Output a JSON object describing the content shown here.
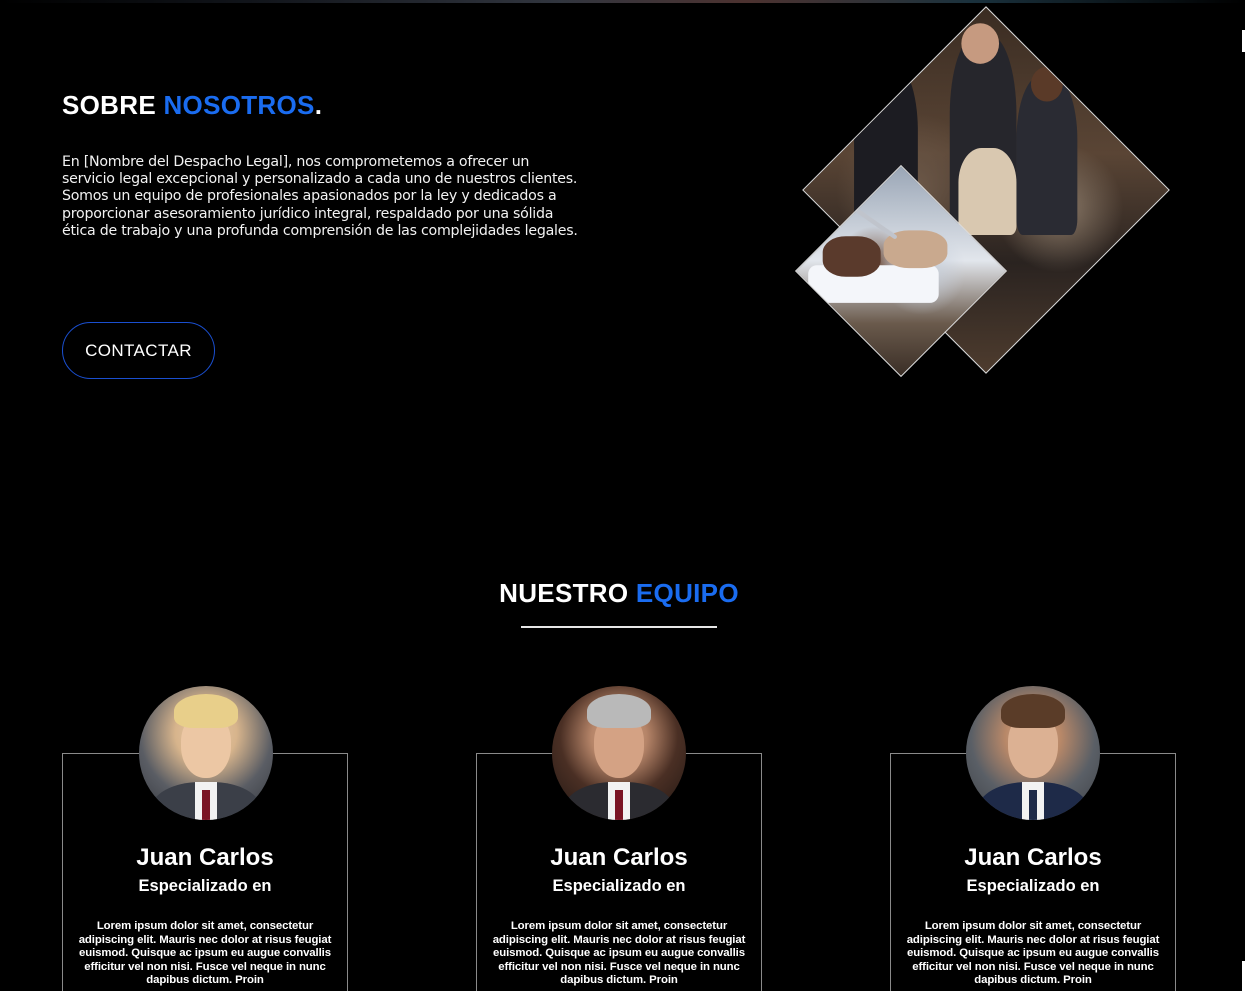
{
  "theme": {
    "accent": "#1a6cf0",
    "background": "#000000",
    "button_border": "#1a4fd0"
  },
  "about": {
    "title_main": "SOBRE ",
    "title_accent": "NOSOTROS",
    "title_dot": ".",
    "text": "En [Nombre del Despacho Legal], nos comprometemos a ofrecer un servicio legal excepcional y personalizado a cada uno de nuestros clientes. Somos un equipo de profesionales apasionados por la ley y dedicados a proporcionar asesoramiento jurídico integral, respaldado por una sólida ética de trabajo y una profunda comprensión de las complejidades legales.",
    "button_label": "CONTACTAR",
    "images": [
      "team-photo",
      "signing-document-photo"
    ]
  },
  "team": {
    "title_main": "NUESTRO ",
    "title_accent": "EQUIPO",
    "members": [
      {
        "name": "Juan Carlos",
        "role": "Especializado en",
        "bio": "Lorem ipsum dolor sit amet, consectetur adipiscing elit. Mauris nec dolor at risus feugiat euismod. Quisque ac ipsum eu augue convallis efficitur vel non nisi. Fusce vel neque in nunc dapibus dictum. Proin",
        "avatar": "young-blond-man-portrait"
      },
      {
        "name": "Juan Carlos",
        "role": "Especializado en",
        "bio": "Lorem ipsum dolor sit amet, consectetur adipiscing elit. Mauris nec dolor at risus feugiat euismod. Quisque ac ipsum eu augue convallis efficitur vel non nisi. Fusce vel neque in nunc dapibus dictum. Proin",
        "avatar": "grey-haired-man-portrait"
      },
      {
        "name": "Juan Carlos",
        "role": "Especializado en",
        "bio": "Lorem ipsum dolor sit amet, consectetur adipiscing elit. Mauris nec dolor at risus feugiat euismod. Quisque ac ipsum eu augue convallis efficitur vel non nisi. Fusce vel neque in nunc dapibus dictum. Proin",
        "avatar": "brown-haired-man-portrait"
      }
    ]
  }
}
